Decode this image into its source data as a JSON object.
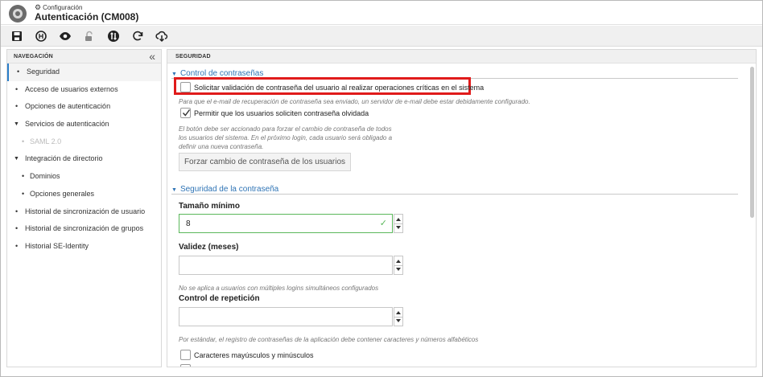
{
  "header": {
    "breadcrumb": "Configuración",
    "title": "Autenticación (CM008)"
  },
  "toolbar": {
    "buttons": [
      "save-icon",
      "history-icon",
      "view-icon",
      "lock-icon",
      "sync-icon",
      "refresh-icon",
      "cloud-download-icon"
    ]
  },
  "sidebar": {
    "title": "NAVEGACIÓN",
    "items": [
      {
        "label": "Seguridad"
      },
      {
        "label": "Acceso de usuarios externos"
      },
      {
        "label": "Opciones de autenticación"
      },
      {
        "label": "Servicios de autenticación"
      },
      {
        "label": "SAML 2.0"
      },
      {
        "label": "Integración de directorio"
      },
      {
        "label": "Dominios"
      },
      {
        "label": "Opciones generales"
      },
      {
        "label": "Historial de sincronización de usuario"
      },
      {
        "label": "Historial de sincronización de grupos"
      },
      {
        "label": "Historial SE-Identity"
      }
    ]
  },
  "main": {
    "title": "SEGURIDAD",
    "password_control": {
      "heading": "Control de contraseñas",
      "require_validation_label": "Solicitar validación de contraseña del usuario al realizar operaciones críticas en el sistema",
      "email_hint": "Para que el e-mail de recuperación de contraseña sea enviado, un servidor de e-mail debe estar debidamente configurado.",
      "allow_forgot_label": "Permitir que los usuarios soliciten contraseña olvidada",
      "force_hint": "El botón debe ser accionado para forzar el cambio de contraseña de todos los usuarios del sistema. En el próximo login, cada usuario será obligado a definir una nueva contraseña.",
      "force_button": "Forzar cambio de contraseña de los usuarios"
    },
    "password_security": {
      "heading": "Seguridad de la contraseña",
      "min_size_label": "Tamaño mínimo",
      "min_size_value": "8",
      "validity_label": "Validez (meses)",
      "validity_value": "",
      "validity_hint": "No se aplica a usuarios con múltiples logins simultáneos configurados",
      "repeat_label": "Control de repetición",
      "repeat_value": "",
      "standard_hint": "Por estándar, el registro de contraseñas de la aplicación debe contener caracteres y números alfabéticos",
      "case_label": "Caracteres mayúsculos y minúsculos"
    }
  },
  "colors": {
    "accent": "#2f74b5",
    "highlight": "#e01b1b",
    "valid": "#5bb85b"
  }
}
